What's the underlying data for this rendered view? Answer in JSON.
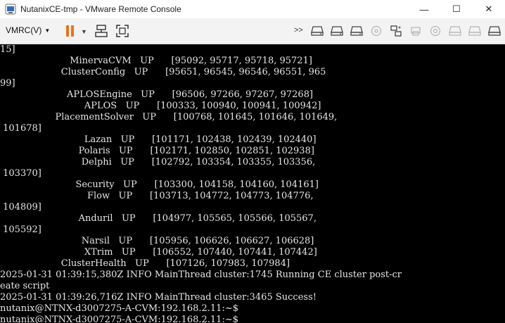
{
  "window": {
    "title": "NutanixCE-tmp - VMware Remote Console",
    "minimize_glyph": "—",
    "maximize_glyph": "☐",
    "close_glyph": "✕"
  },
  "toolbar": {
    "menu_label": "VMRC(V)",
    "menu_caret": "▼",
    "pause_caret": "▼",
    "overflow_label": ">>"
  },
  "console": {
    "lines": [
      "15]",
      "                        MinervaCVM   UP      [95092, 95717, 95718, 95721]",
      "                     ClusterConfig   UP      [95651, 96545, 96546, 96551, 965",
      "99]",
      "                       APLOSEngine   UP      [96506, 97266, 97267, 97268]",
      "                             APLOS   UP      [100333, 100940, 100941, 100942]",
      "                   PlacementSolver   UP      [100768, 101645, 101646, 101649,",
      " 101678]",
      "                             Lazan   UP      [101171, 102438, 102439, 102440]",
      "                           Polaris   UP      [102171, 102850, 102851, 102938]",
      "                            Delphi   UP      [102792, 103354, 103355, 103356,",
      " 103370]",
      "                          Security   UP      [103300, 104158, 104160, 104161]",
      "                              Flow   UP      [103713, 104772, 104773, 104776,",
      " 104809]",
      "                           Anduril   UP      [104977, 105565, 105566, 105567,",
      " 105592]",
      "                            Narsil   UP      [105956, 106626, 106627, 106628]",
      "                             XTrim   UP      [106552, 107440, 107441, 107442]",
      "                     ClusterHealth   UP      [107126, 107983, 107984]",
      "2025-01-31 01:39:15,380Z INFO MainThread cluster:1745 Running CE cluster post-cr",
      "eate script",
      "2025-01-31 01:39:26,716Z INFO MainThread cluster:3465 Success!",
      "nutanix@NTNX-d3007275-A-CVM:192.168.2.11:~$",
      "nutanix@NTNX-d3007275-A-CVM:192.168.2.11:~$"
    ]
  },
  "colors": {
    "console_bg": "#000000",
    "console_text": "#e6e6e6",
    "pause_orange": "#e8741a",
    "toolbar_bg": "#f3f3f3"
  }
}
